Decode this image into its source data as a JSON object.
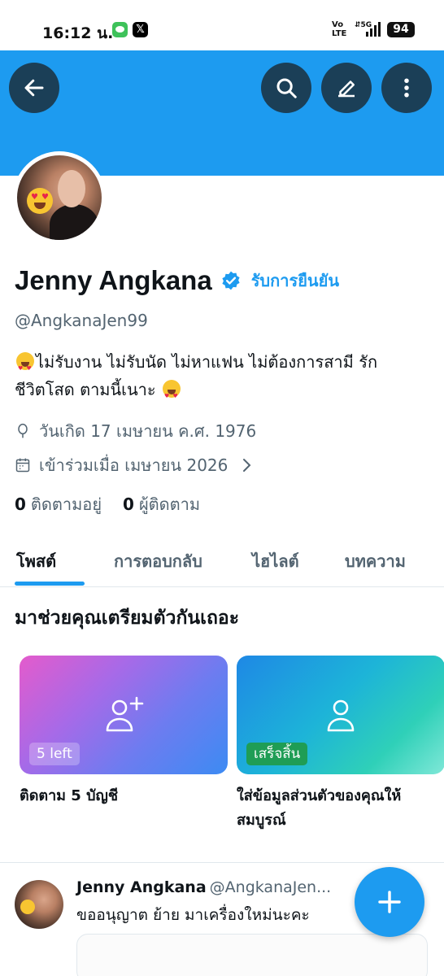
{
  "status_bar": {
    "time": "16:12 น.",
    "x_app": "𝕏",
    "network": "VoLTE",
    "signal": "5G",
    "battery": "94"
  },
  "header": {
    "back_icon": "arrow-left-icon",
    "search_icon": "search-icon",
    "edit_icon": "pencil-icon",
    "more_icon": "more-vertical-icon",
    "banner_color": "#1d9bf0"
  },
  "profile": {
    "name": "Jenny Angkana",
    "verified_icon": "verified-badge-icon",
    "get_verified": "รับการยืนยัน",
    "handle": "@AngkanaJen99",
    "bio_line1": "ไม่รับงาน  ไม่รับนัด ไม่หาแฟน ไม่ต้องการสามี   รัก",
    "bio_line2": "ชีวิตโสด ตามนี้เนาะ",
    "birthday": "วันเกิด 17 เมษายน ค.ศ. 1976",
    "joined": "เข้าร่วมเมื่อ เมษายน 2026",
    "following_count": "0",
    "following_label": "ติดตามอยู่",
    "followers_count": "0",
    "followers_label": "ผู้ติดตาม"
  },
  "tabs": [
    {
      "label": "โพสต์"
    },
    {
      "label": "การตอบกลับ"
    },
    {
      "label": "ไฮไลต์"
    },
    {
      "label": "บทความ"
    }
  ],
  "get_ready": {
    "title": "มาช่วยคุณเตรียมตัวกันเถอะ",
    "cards": [
      {
        "badge": "5 left",
        "caption": "ติดตาม 5 บัญชี",
        "icon": "add-user-icon"
      },
      {
        "badge": "เสร็จสิ้น",
        "caption": "ใส่ข้อมูลส่วนตัวของคุณให้สมบูรณ์",
        "icon": "user-icon"
      }
    ]
  },
  "post": {
    "name": "Jenny Angkana",
    "handle": "@AngkanaJen...",
    "text": "ขออนุญาต ย้าย มาเครื่องใหม่นะคะ"
  },
  "fab_icon": "plus-icon"
}
